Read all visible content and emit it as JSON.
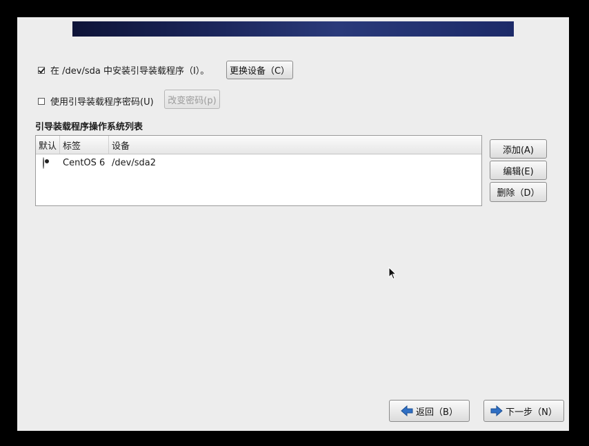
{
  "bootloader": {
    "install_label": "在 /dev/sda 中安装引导装载程序（I）。",
    "install_checked": true,
    "change_device_label": "更换设备（C）",
    "password_label": "使用引导装载程序密码(U)",
    "password_checked": false,
    "change_password_label": "改变密码(p)"
  },
  "os_list": {
    "title": "引导装载程序操作系统列表",
    "columns": [
      "默认",
      "标签",
      "设备"
    ],
    "rows": [
      {
        "default": true,
        "label": "CentOS 6",
        "device": "/dev/sda2"
      }
    ],
    "add_label": "添加(A)",
    "edit_label": "编辑(E)",
    "delete_label": "删除（D）"
  },
  "nav": {
    "back_label": "返回（B）",
    "next_label": "下一步（N）"
  },
  "colors": {
    "background": "#ededed",
    "arrow_blue": "#2f6fc4"
  }
}
